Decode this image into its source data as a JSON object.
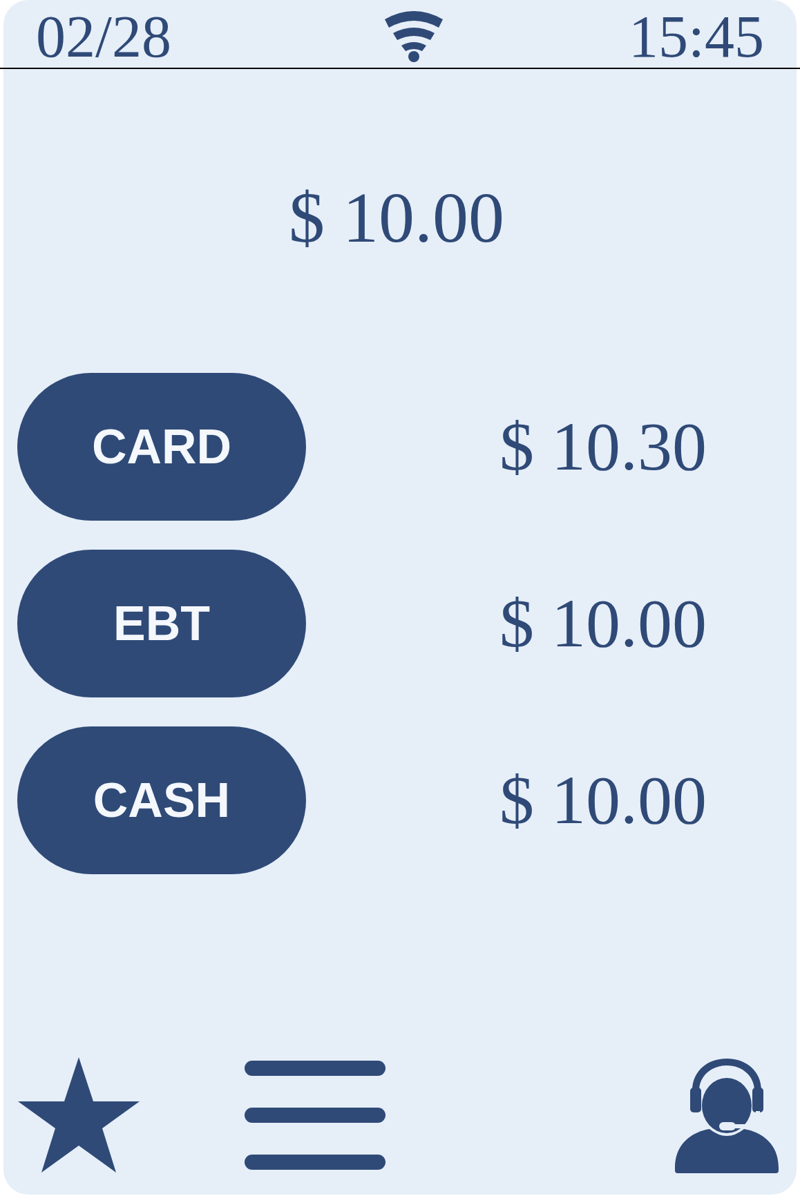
{
  "status_bar": {
    "date": "02/28",
    "time": "15:45"
  },
  "total": "$ 10.00",
  "payment_options": [
    {
      "label": "CARD",
      "amount": "$ 10.30"
    },
    {
      "label": "EBT",
      "amount": "$ 10.00"
    },
    {
      "label": "CASH",
      "amount": "$ 10.00"
    }
  ]
}
